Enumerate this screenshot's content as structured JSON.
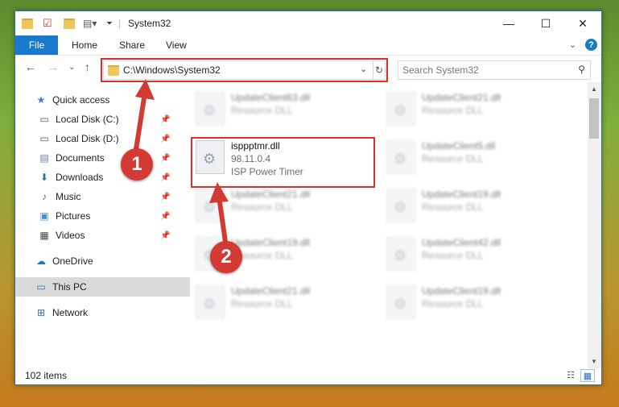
{
  "window": {
    "title": "System32",
    "controls": {
      "minimize": "—",
      "maximize": "☐",
      "close": "✕"
    }
  },
  "ribbon": {
    "tabs": [
      "File",
      "Home",
      "Share",
      "View"
    ],
    "help": "?"
  },
  "nav": {
    "address": "C:\\Windows\\System32",
    "search_placeholder": "Search System32"
  },
  "sidebar": {
    "items": [
      {
        "label": "Quick access",
        "icon": "star-icon",
        "pinned": false
      },
      {
        "label": "Local Disk (C:)",
        "icon": "drive-icon",
        "pinned": true
      },
      {
        "label": "Local Disk (D:)",
        "icon": "drive-icon",
        "pinned": true
      },
      {
        "label": "Documents",
        "icon": "documents-icon",
        "pinned": true
      },
      {
        "label": "Downloads",
        "icon": "downloads-icon",
        "pinned": true
      },
      {
        "label": "Music",
        "icon": "music-icon",
        "pinned": true
      },
      {
        "label": "Pictures",
        "icon": "pictures-icon",
        "pinned": true
      },
      {
        "label": "Videos",
        "icon": "videos-icon",
        "pinned": true
      },
      {
        "label": "OneDrive",
        "icon": "onedrive-icon",
        "pinned": false
      },
      {
        "label": "This PC",
        "icon": "pc-icon",
        "pinned": false,
        "selected": true
      },
      {
        "label": "Network",
        "icon": "network-icon",
        "pinned": false
      }
    ]
  },
  "files": {
    "highlighted": {
      "name": "isppptmr.dll",
      "version": "98.11.0.4",
      "description": "ISP Power Timer"
    },
    "left": [
      {
        "name": "UpdateClient63.dll",
        "desc": "Resource DLL"
      },
      {
        "name": "UpdateClient21.dll",
        "desc": "Resource DLL"
      },
      {
        "name": "UpdateClient19.dll",
        "desc": "Resource DLL"
      },
      {
        "name": "UpdateClient21.dll",
        "desc": "Resource DLL"
      }
    ],
    "right": [
      {
        "name": "UpdateClient21.dll",
        "desc": "Resource DLL"
      },
      {
        "name": "UpdateClient5.dll",
        "desc": "Resource DLL"
      },
      {
        "name": "UpdateClient19.dll",
        "desc": "Resource DLL"
      },
      {
        "name": "UpdateClient42.dll",
        "desc": "Resource DLL"
      },
      {
        "name": "UpdateClient19.dll",
        "desc": "Resource DLL"
      }
    ]
  },
  "status": {
    "items_count": "102 items"
  },
  "callouts": [
    "1",
    "2"
  ],
  "colors": {
    "accent": "#1979ca",
    "highlight": "#d9302c",
    "callout": "#d23a33"
  }
}
